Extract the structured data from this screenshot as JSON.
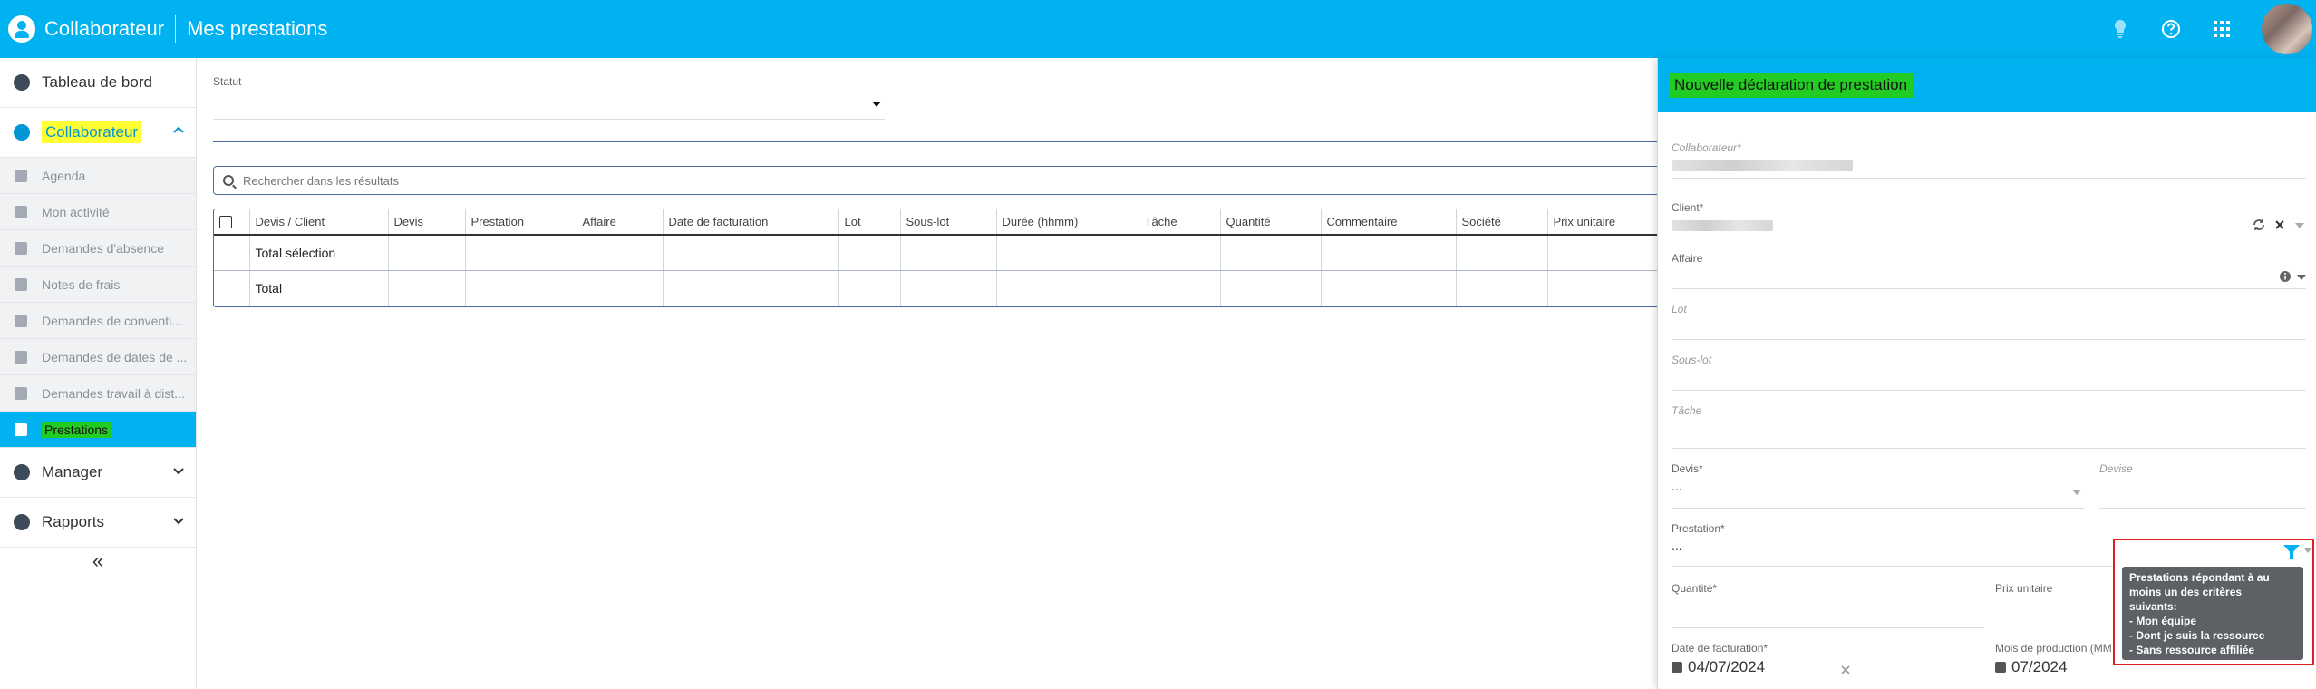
{
  "header": {
    "app_name": "Collaborateur",
    "page_title": "Mes prestations",
    "icons": [
      "lightbulb-icon",
      "help-icon",
      "apps-grid-icon"
    ]
  },
  "sidebar": {
    "main_items": [
      {
        "label": "Tableau de bord",
        "icon": "dashboard-icon"
      },
      {
        "label": "Collaborateur",
        "icon": "user-circle-icon",
        "expanded": true
      },
      {
        "label": "Manager",
        "icon": "globe-icon"
      },
      {
        "label": "Rapports",
        "icon": "report-icon"
      }
    ],
    "sub_items": [
      {
        "label": "Agenda"
      },
      {
        "label": "Mon activité"
      },
      {
        "label": "Demandes d'absence"
      },
      {
        "label": "Notes de frais"
      },
      {
        "label": "Demandes de conventi..."
      },
      {
        "label": "Demandes de dates de ..."
      },
      {
        "label": "Demandes travail à dist..."
      },
      {
        "label": "Prestations",
        "selected": true
      }
    ],
    "collapse_label": "«"
  },
  "main": {
    "filter_label": "Statut",
    "filter_value": "",
    "search_placeholder": "Rechercher dans les résultats",
    "columns": [
      "Devis / Client",
      "Devis",
      "Prestation",
      "Affaire",
      "Date de facturation",
      "Lot",
      "Sous-lot",
      "Durée (hhmm)",
      "Tâche",
      "Quantité",
      "Commentaire",
      "Société",
      "Prix unitaire"
    ],
    "rows": [
      {
        "label": "Total sélection"
      },
      {
        "label": "Total"
      }
    ]
  },
  "panel": {
    "title": "Nouvelle déclaration de prestation",
    "fields": {
      "collaborateur": "Collaborateur*",
      "client": "Client*",
      "affaire": "Affaire",
      "lot": "Lot",
      "sous_lot": "Sous-lot",
      "tache": "Tâche",
      "devis": "Devis*",
      "devis_value": "...",
      "devise": "Devise",
      "prestation": "Prestation*",
      "prestation_value": "...",
      "quantite": "Quantité*",
      "prix_unitaire": "Prix unitaire",
      "date_facturation": "Date de facturation*",
      "date_facturation_value": "04/07/2024",
      "mois_production": "Mois de production (MM",
      "mois_production_value": "07/2024"
    },
    "tooltip": {
      "lines": [
        "Prestations répondant à au",
        "moins un des critères",
        "suivants:",
        "- Mon équipe",
        "- Dont je suis la ressource",
        "- Sans ressource affiliée"
      ]
    }
  },
  "colors": {
    "brand": "#00b2f0",
    "highlight_yellow": "#ffff33",
    "highlight_green": "#22cc22",
    "annotation_red": "#e02020"
  }
}
